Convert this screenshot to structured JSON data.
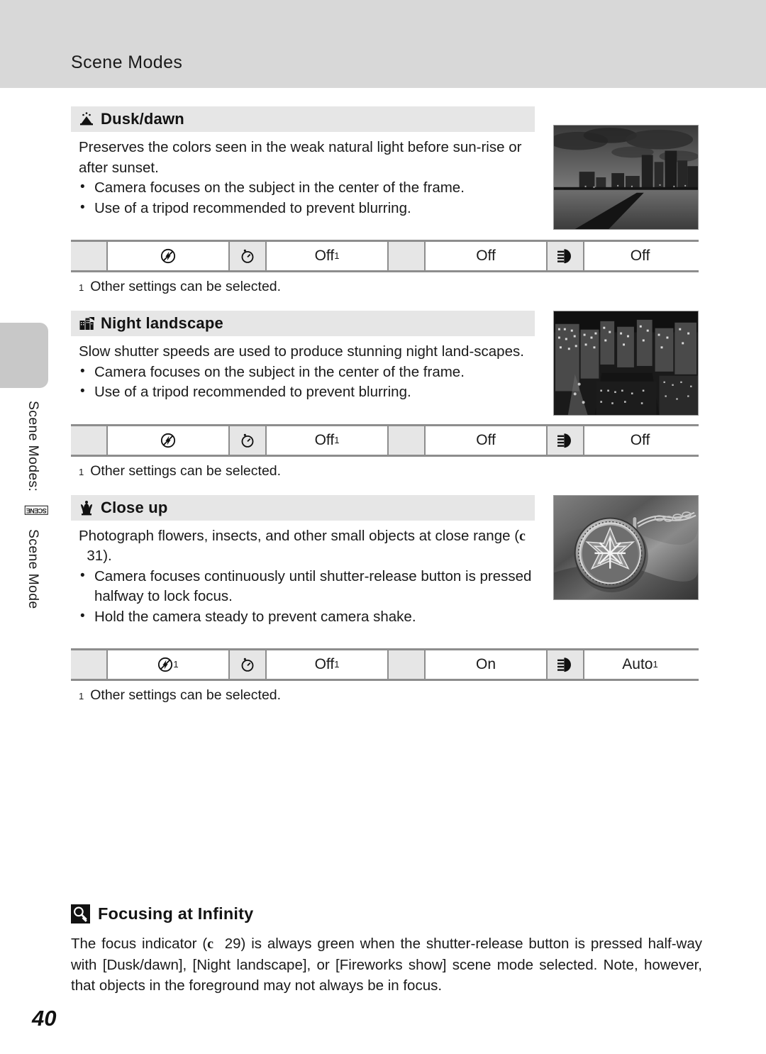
{
  "header": {
    "title": "Scene Modes"
  },
  "sidebar": {
    "label_part1": "Scene Modes:",
    "scene_glyph": "SCENE",
    "label_part2": "Scene Mode"
  },
  "page_number": "40",
  "reference_glyph": "c",
  "sections": [
    {
      "id": "dusk-dawn",
      "icon": "dusk-dawn-icon",
      "title": "Dusk/dawn",
      "paragraph": "Preserves the colors seen in the weak natural light before sun-rise or after sunset.",
      "bullets": [
        "Camera focuses on the subject in the center of the frame.",
        "Use of a tripod recommended to prevent blurring."
      ],
      "photo_alt": "dusk-cityscape-photo",
      "table": {
        "flash_icon": "flash-off-icon",
        "flash_value": "",
        "flash_sup": "",
        "timer_icon": "self-timer-icon",
        "timer_value": "Off",
        "timer_sup": "1",
        "macro_icon": "macro-icon",
        "macro_value": "Off",
        "macro_sup": "",
        "exposure_icon": "exposure-compensation-icon",
        "exposure_value": "Off",
        "exposure_sup": ""
      },
      "footnote_num": "1",
      "footnote": "Other settings can be selected."
    },
    {
      "id": "night-landscape",
      "icon": "night-landscape-icon",
      "title": "Night landscape",
      "paragraph": "Slow shutter speeds are used to produce stunning night land-scapes.",
      "bullets": [
        "Camera focuses on the subject in the center of the frame.",
        "Use of a tripod recommended to prevent blurring."
      ],
      "photo_alt": "night-cityscape-photo",
      "table": {
        "flash_icon": "flash-off-icon",
        "flash_value": "",
        "flash_sup": "",
        "timer_icon": "self-timer-icon",
        "timer_value": "Off",
        "timer_sup": "1",
        "macro_icon": "macro-icon",
        "macro_value": "Off",
        "macro_sup": "",
        "exposure_icon": "exposure-compensation-icon",
        "exposure_value": "Off",
        "exposure_sup": ""
      },
      "footnote_num": "1",
      "footnote": "Other settings can be selected."
    },
    {
      "id": "close-up",
      "icon": "close-up-icon",
      "title": "Close up",
      "paragraph_before_ref": "Photograph flowers, insects, and other small objects at close range (",
      "paragraph_ref_page": "31",
      "paragraph_after_ref": ").",
      "bullets": [
        "Camera focuses continuously until shutter-release button is pressed halfway to lock focus.",
        "Hold the camera steady to prevent camera shake."
      ],
      "photo_alt": "pendant-close-up-photo",
      "table": {
        "flash_icon": "flash-off-icon",
        "flash_value": "",
        "flash_sup": "1",
        "timer_icon": "self-timer-icon",
        "timer_value": "Off",
        "timer_sup": "1",
        "macro_icon": "macro-icon",
        "macro_value": "On",
        "macro_sup": "",
        "exposure_icon": "exposure-compensation-icon",
        "exposure_value": "Auto",
        "exposure_sup": "1"
      },
      "footnote_num": "1",
      "footnote": "Other settings can be selected."
    }
  ],
  "tip": {
    "icon": "tip-magnifier-icon",
    "title": "Focusing at Infinity",
    "text_before_ref": "The focus indicator (",
    "ref_page": "29",
    "text_after_ref": ") is always green when the shutter-release button is pressed half-way with [Dusk/dawn], [Night landscape], or [Fireworks show] scene mode selected. Note, however, that objects in the foreground may not always be in focus."
  }
}
